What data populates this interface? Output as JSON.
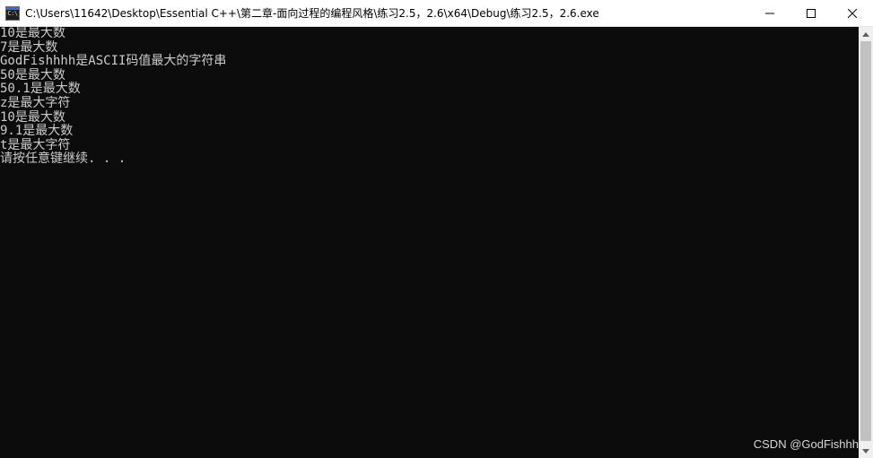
{
  "window": {
    "icon_text": "C:\\",
    "title": "C:\\Users\\11642\\Desktop\\Essential C++\\第二章-面向过程的编程风格\\练习2.5，2.6\\x64\\Debug\\练习2.5，2.6.exe",
    "minimize_icon": "minimize-icon",
    "maximize_icon": "maximize-icon",
    "close_icon": "close-icon"
  },
  "console": {
    "background": "#0c0c0c",
    "text_color": "#cccccc",
    "lines": [
      "10是最大数",
      "7是最大数",
      "GodFishhhh是ASCII码值最大的字符串",
      "50是最大数",
      "50.1是最大数",
      "z是最大字符",
      "10是最大数",
      "9.1是最大数",
      "t是最大字符",
      "请按任意键继续. . ."
    ]
  },
  "watermark": {
    "text": "CSDN @GodFishhh"
  }
}
